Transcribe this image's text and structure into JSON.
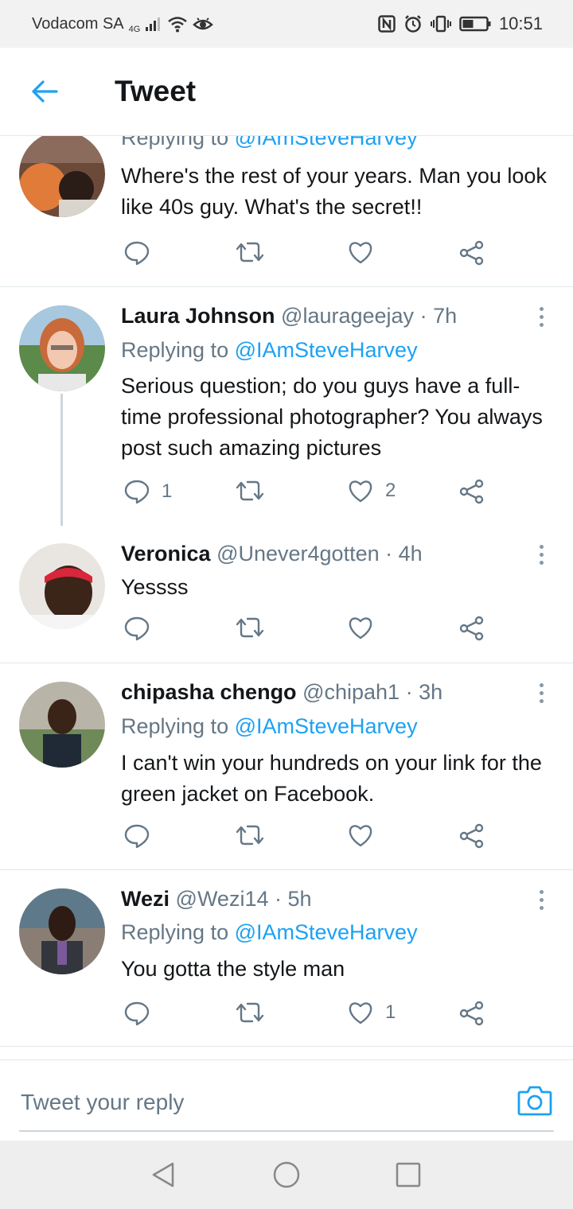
{
  "status_bar": {
    "carrier": "Vodacom SA",
    "network": "4G",
    "time": "10:51"
  },
  "header": {
    "title": "Tweet",
    "back_icon": "arrow-left-icon"
  },
  "colors": {
    "accent": "#1da1f2",
    "text": "#14171a",
    "secondary": "#657786",
    "divider": "#e1e8ed"
  },
  "tweets": [
    {
      "name": "",
      "handle": "",
      "time": "",
      "replying_prefix": "Replying to ",
      "replying_handle": "@IAmSteveHarvey",
      "text": "Where's the rest of your years. Man you look like  40s guy. What's the secret!!",
      "reply_count": "",
      "retweet_count": "",
      "like_count": ""
    },
    {
      "name": "Laura Johnson",
      "handle": "@laurageejay",
      "time": "· 7h",
      "replying_prefix": "Replying to ",
      "replying_handle": "@IAmSteveHarvey",
      "text": "Serious question; do you guys have a full-time professional photographer? You always post such amazing pictures",
      "reply_count": "1",
      "retweet_count": "",
      "like_count": "2"
    },
    {
      "name": "Veronica",
      "handle": "@Unever4gotten",
      "time": "· 4h",
      "text": "Yessss",
      "reply_count": "",
      "retweet_count": "",
      "like_count": ""
    },
    {
      "name": "chipasha chengo",
      "handle": "@chipah1",
      "time": "· 3h",
      "replying_prefix": "Replying to ",
      "replying_handle": "@IAmSteveHarvey",
      "text": "I can't win your hundreds on your link for the green jacket on Facebook.",
      "reply_count": "",
      "retweet_count": "",
      "like_count": ""
    },
    {
      "name": "Wezi",
      "handle": "@Wezi14",
      "time": "· 5h",
      "replying_prefix": "Replying to ",
      "replying_handle": "@IAmSteveHarvey",
      "text": "You gotta the style man",
      "reply_count": "",
      "retweet_count": "",
      "like_count": "1"
    }
  ],
  "reply_bar": {
    "placeholder": "Tweet your reply"
  }
}
